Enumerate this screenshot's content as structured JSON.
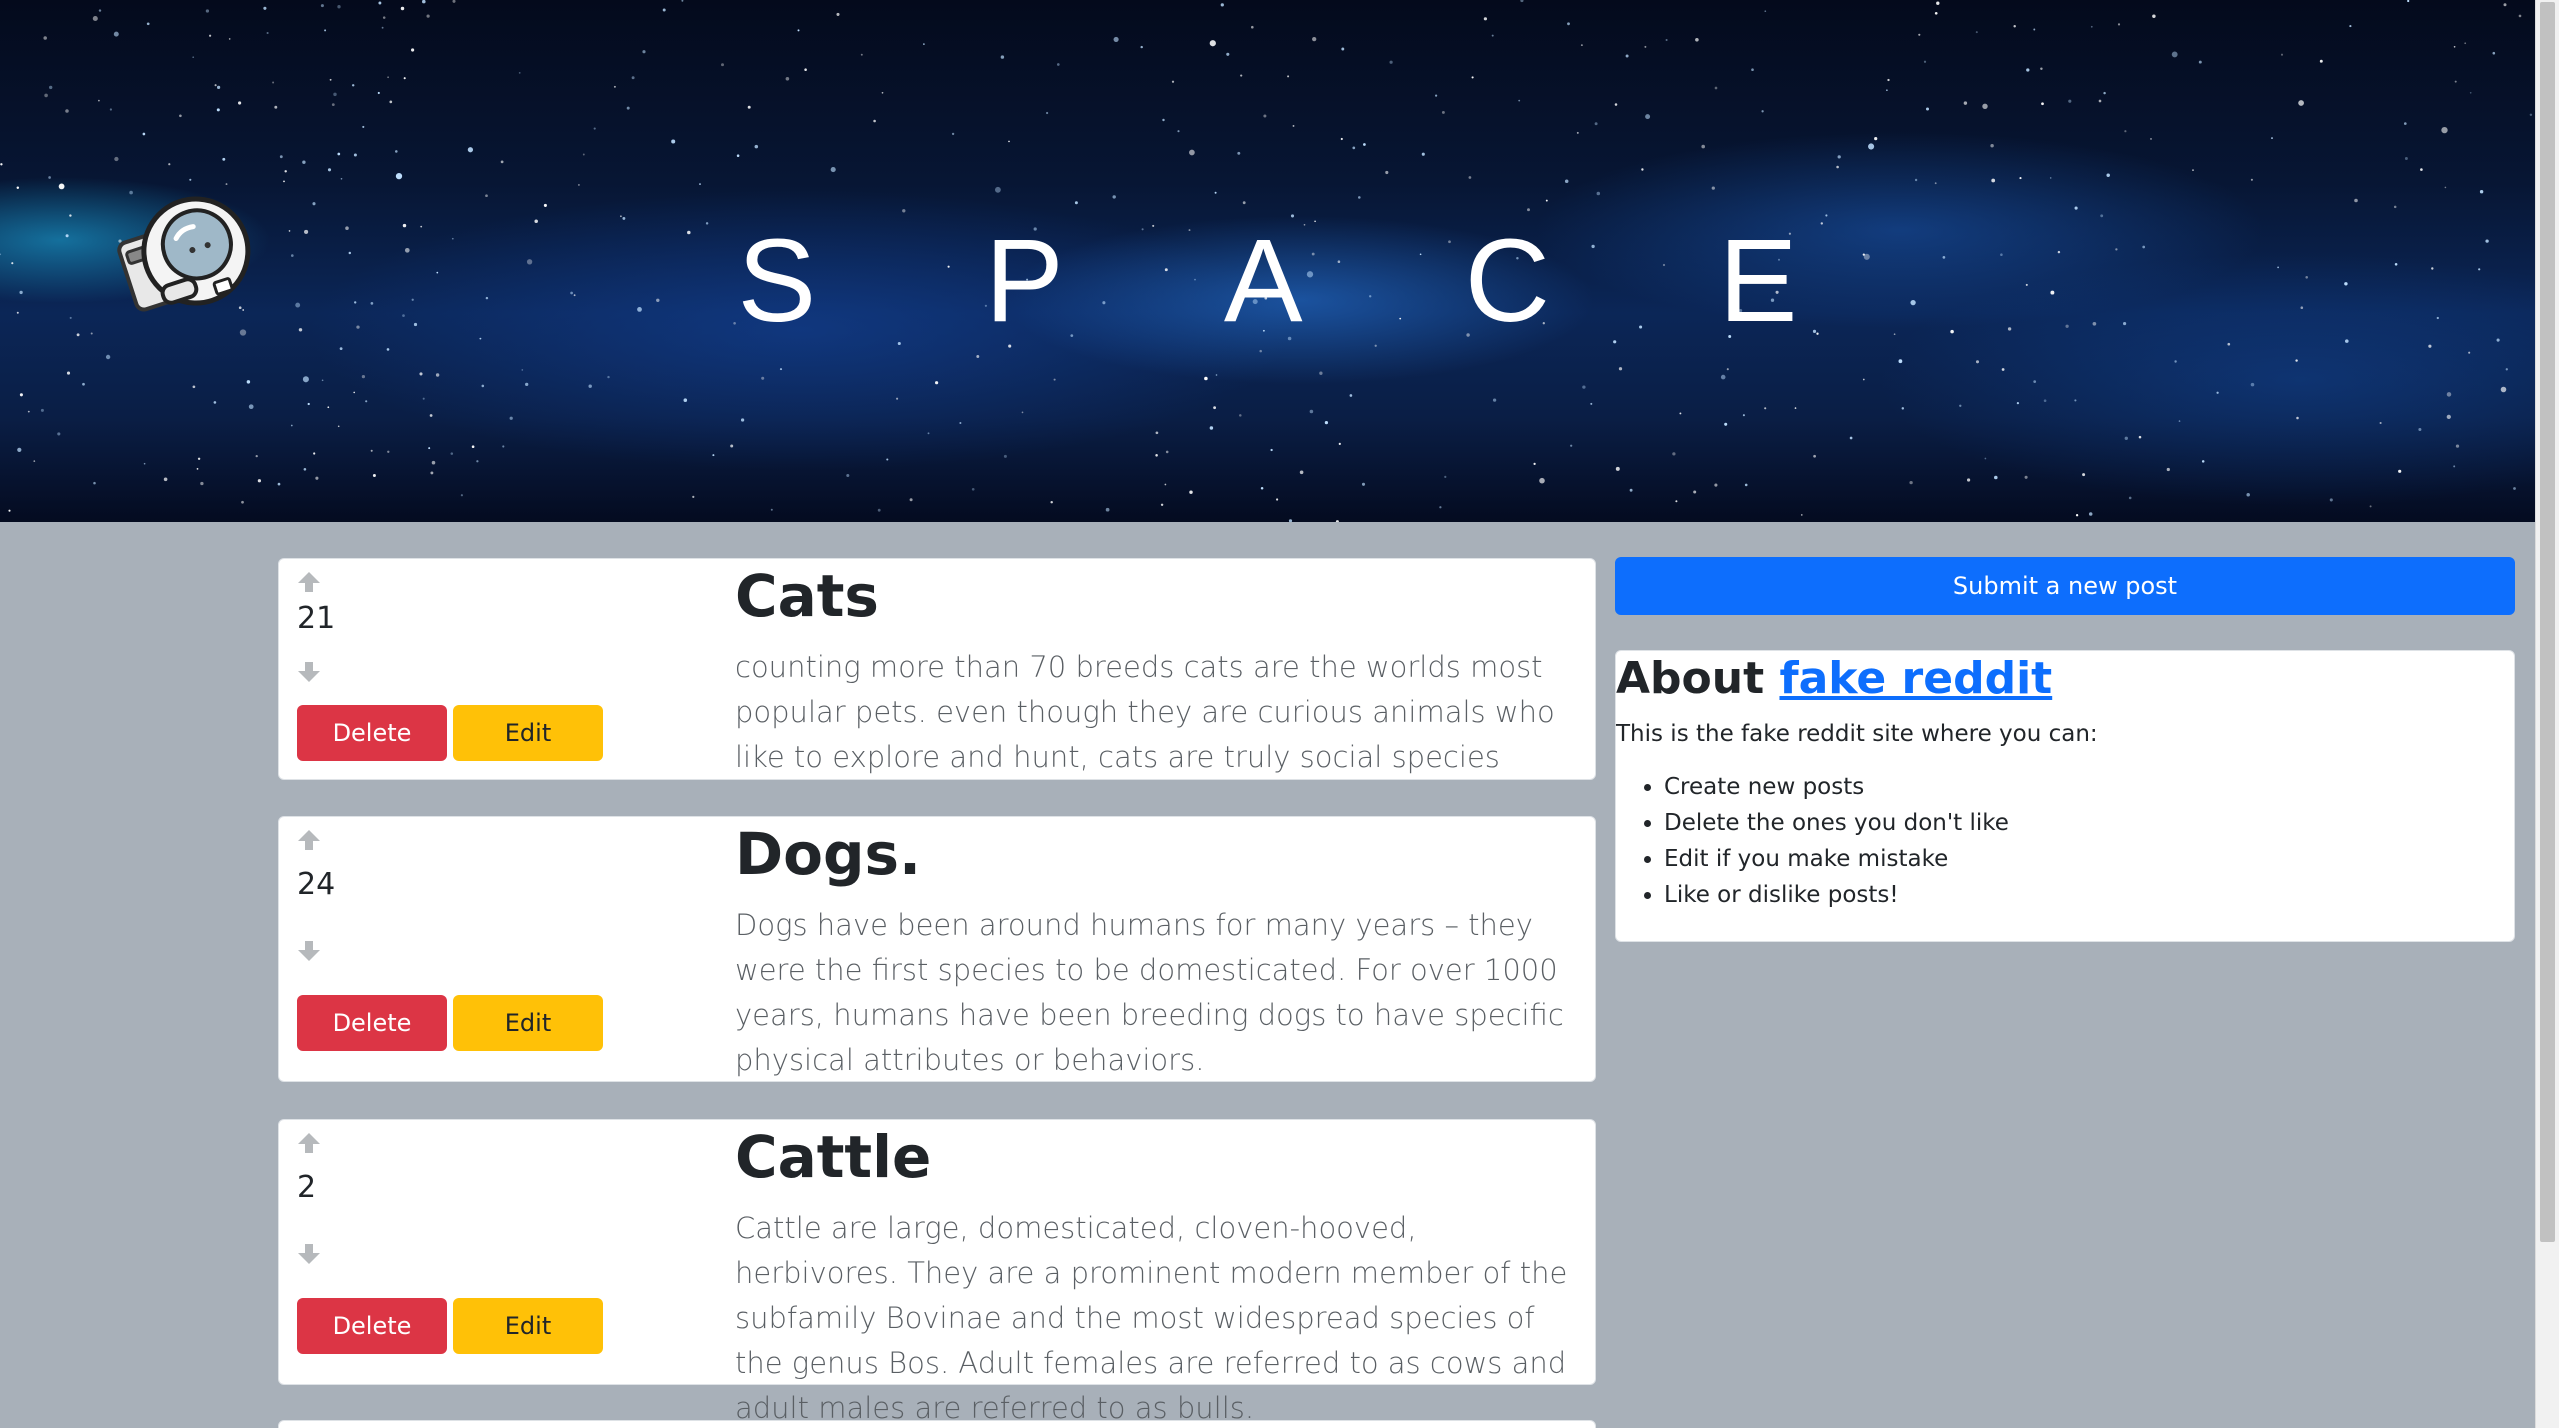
{
  "banner": {
    "title": "S P A C E",
    "logo_icon": "astronaut-icon"
  },
  "posts": [
    {
      "votes": "21",
      "title": "Cats",
      "body": "counting more than 70 breeds cats are the worlds most popular pets. even though they are curious animals who like to explore and hunt, cats are truly social species",
      "delete_label": "Delete",
      "edit_label": "Edit"
    },
    {
      "votes": "24",
      "title": "Dogs.",
      "body": "Dogs have been around humans for many years – they were the first species to be domesticated. For over 1000 years, humans have been breeding dogs to have specific physical attributes or behaviors.",
      "delete_label": "Delete",
      "edit_label": "Edit"
    },
    {
      "votes": "2",
      "title": "Cattle",
      "body": "Cattle are large, domesticated, cloven-hooved, herbivores. They are a prominent modern member of the subfamily Bovinae and the most widespread species of the genus Bos. Adult females are referred to as cows and adult males are referred to as bulls.",
      "delete_label": "Delete",
      "edit_label": "Edit"
    }
  ],
  "sidebar": {
    "submit_label": "Submit a new post",
    "about": {
      "heading_prefix": "About",
      "link_text": "fake reddit",
      "intro": "This is the fake reddit site where you can:",
      "items": [
        "Create new posts",
        "Delete the ones you don't like",
        "Edit if you make mistake",
        "Like or dislike posts!"
      ]
    }
  },
  "colors": {
    "page_background": "#a8b0b9",
    "delete": "#dc3545",
    "edit": "#ffc107",
    "primary": "#0d6efd"
  }
}
